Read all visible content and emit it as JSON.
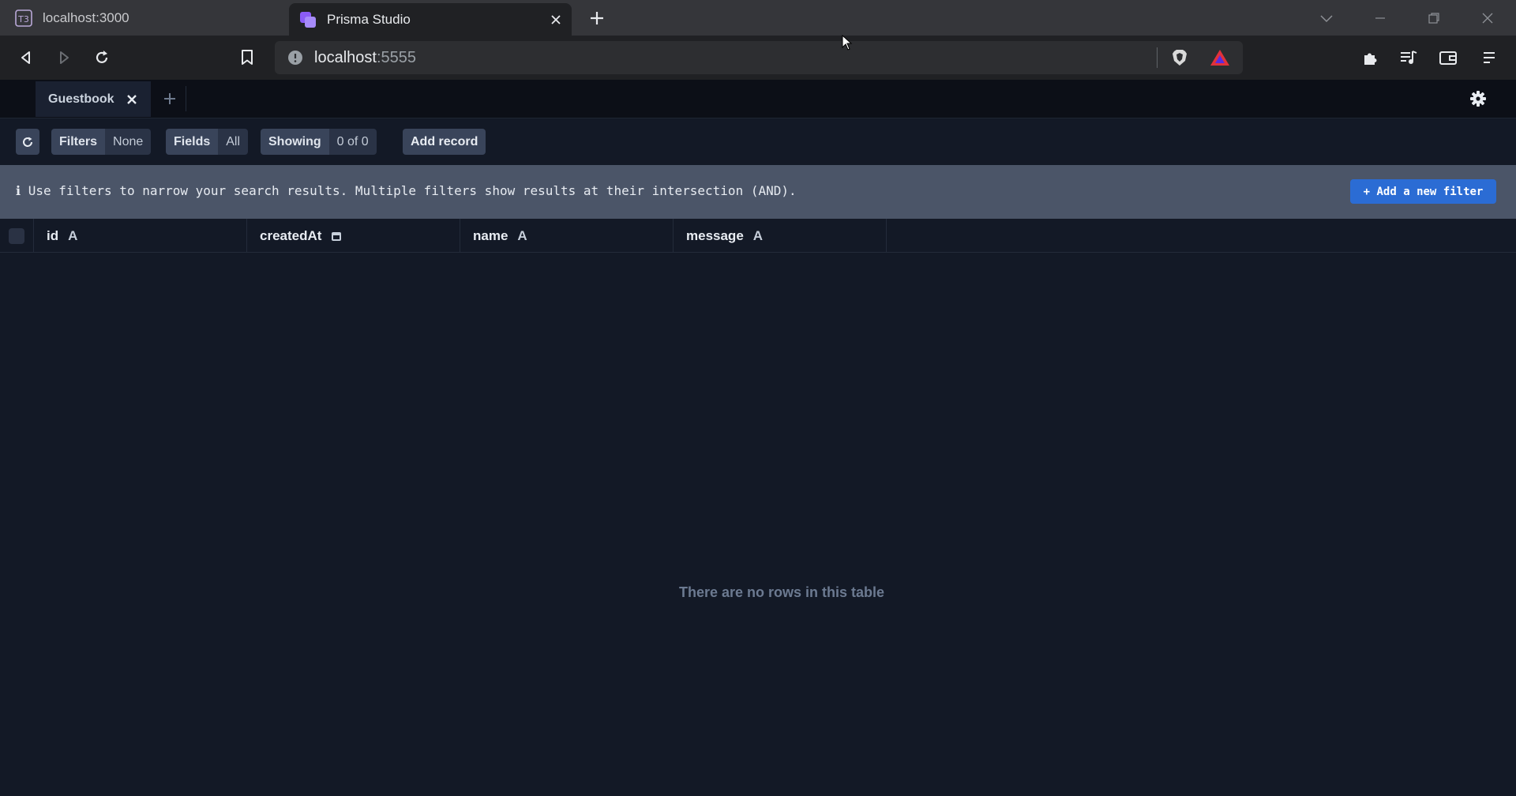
{
  "browser": {
    "tabs": [
      {
        "title": "localhost:3000",
        "favicon": "t3-icon",
        "active": false
      },
      {
        "title": "Prisma Studio",
        "favicon": "prisma-icon",
        "active": true
      }
    ],
    "url_host": "localhost",
    "url_port": ":5555"
  },
  "studio": {
    "model_tab": "Guestbook",
    "toolbar": {
      "filters_label": "Filters",
      "filters_value": "None",
      "fields_label": "Fields",
      "fields_value": "All",
      "showing_label": "Showing",
      "showing_value": "0 of 0",
      "add_record": "Add record"
    },
    "filter_info": "ℹ Use filters to narrow your search results. Multiple filters show results at their intersection (AND).",
    "add_filter": "+ Add a new filter",
    "columns": [
      {
        "name": "id",
        "type_icon": "A"
      },
      {
        "name": "createdAt",
        "type_icon": "calendar-icon"
      },
      {
        "name": "name",
        "type_icon": "A"
      },
      {
        "name": "message",
        "type_icon": "A"
      }
    ],
    "empty_message": "There are no rows in this table"
  },
  "colors": {
    "accent_blue": "#2b6cd4",
    "background": "#131926",
    "filter_bar": "#4b5568"
  }
}
